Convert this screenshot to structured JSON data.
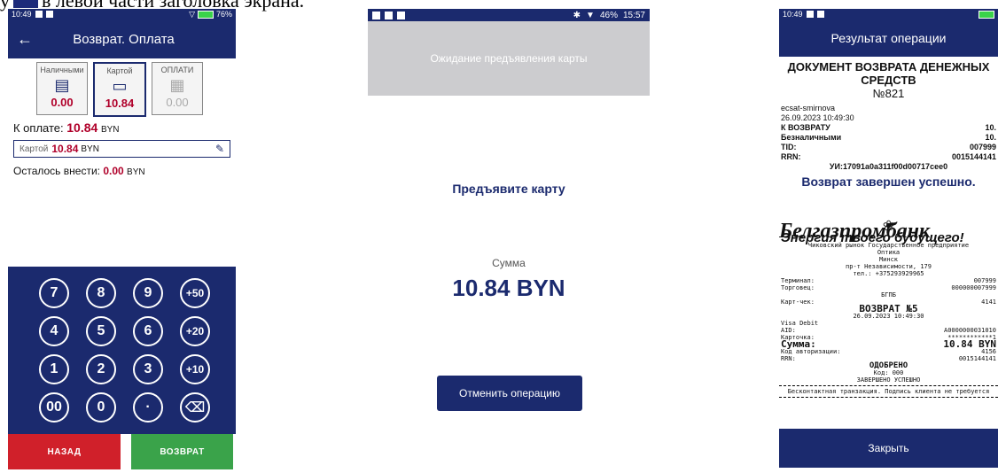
{
  "caption": {
    "before": "у",
    "after": "в левой части заголовка экрана."
  },
  "screen1": {
    "status": {
      "time": "10:49",
      "battery": "76%"
    },
    "title": "Возврат. Оплата",
    "methods": [
      {
        "label": "Наличными",
        "value": "0.00",
        "icon": "cash-icon"
      },
      {
        "label": "Картой",
        "value": "10.84",
        "icon": "card-icon"
      },
      {
        "label": "ОПЛАТИ",
        "value": "0.00",
        "icon": "qr-icon"
      }
    ],
    "to_pay_label": "К оплате:",
    "to_pay_value": "10.84",
    "currency": "BYN",
    "card_label": "Картой",
    "card_value": "10.84",
    "remaining_label": "Осталось внести:",
    "remaining_value": "0.00",
    "keys": [
      "7",
      "8",
      "9",
      "+50",
      "4",
      "5",
      "6",
      "+20",
      "1",
      "2",
      "3",
      "+10",
      "00",
      "0",
      "·",
      "⌫"
    ],
    "back_button": "НАЗАД",
    "return_button": "ВОЗВРАТ"
  },
  "screen2": {
    "status": {
      "battery": "46%",
      "time": "15:57"
    },
    "header": "Ожидание предъявления карты",
    "present": "Предъявите карту",
    "sum_label": "Сумма",
    "sum_value": "10.84 BYN",
    "cancel": "Отменить операцию"
  },
  "screen3": {
    "status": {
      "time": "10:49"
    },
    "title": "Результат операции",
    "doc_title": "ДОКУМЕНТ ВОЗВРАТА ДЕНЕЖНЫХ СРЕДСТВ",
    "doc_number": "№821",
    "user": "ecsat-smirnova",
    "datetime": "26.09.2023 10:49:30",
    "lines": [
      {
        "label": "К ВОЗВРАТУ",
        "value": "10.",
        "bold": true
      },
      {
        "label": "Безналичными",
        "value": "10.",
        "bold": true
      },
      {
        "label": "TID:",
        "value": "007999",
        "bold": true
      },
      {
        "label": "RRN:",
        "value": "0015144141",
        "bold": true
      }
    ],
    "uid": "УИ:17091a0a311f00d00717cee0",
    "success": "Возврат завершен успешно.",
    "slip": {
      "logo": "Белгазпромбанк",
      "slogan": "Энергия твоего будущего!",
      "org": "Чиковский рынок Государственное предприятие",
      "org2": "Оптика",
      "city": "Минск",
      "addr": "пр-т Независимости, 179",
      "tel": "тел.: +375293929965",
      "terminal_label": "Терминал:",
      "terminal_value": "007999",
      "merchant_label": "Торговец:",
      "merchant_value": "000000007999",
      "bank": "БГПБ",
      "check_label": "Карт-чек:",
      "check_value": "4141",
      "op": "ВОЗВРАТ №5",
      "op_dt": "26.09.2023 10:49:30",
      "card_type": "Visa Debit",
      "aid_label": "AID:",
      "aid_value": "A0000000031010",
      "cardno_label": "Карточка:",
      "cardno_value": "************1",
      "sum_label": "Сумма:",
      "sum_value": "10.84 BYN",
      "auth_label": "Код авторизации:",
      "auth_value": "4156",
      "rrn_label": "RRN:",
      "rrn_value": "0015144141",
      "approved": "ОДОБРЕНО",
      "code": "Код: 000",
      "done": "ЗАВЕРШЕНО УСПЕШНО",
      "contactless": "Бесконтактная транзакция. Подпись клиента не требуется"
    },
    "close": "Закрыть"
  }
}
